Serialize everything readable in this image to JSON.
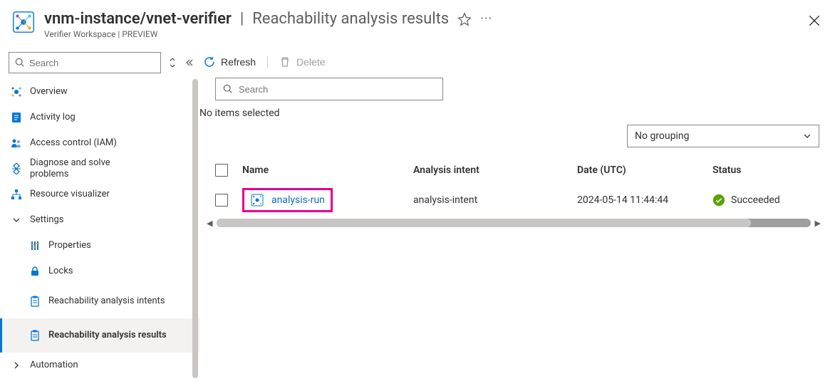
{
  "header": {
    "title_main": "vnm-instance/vnet-verifier",
    "title_section": "Reachability analysis results",
    "subtitle": "Verifier Workspace | PREVIEW"
  },
  "sidebar": {
    "search_placeholder": "Search",
    "items": [
      {
        "label": "Overview",
        "icon": "overview"
      },
      {
        "label": "Activity log",
        "icon": "activity"
      },
      {
        "label": "Access control (IAM)",
        "icon": "access"
      },
      {
        "label": "Diagnose and solve problems",
        "icon": "diagnose"
      },
      {
        "label": "Resource visualizer",
        "icon": "visualizer"
      }
    ],
    "settings_label": "Settings",
    "settings_items": [
      {
        "label": "Properties",
        "icon": "properties"
      },
      {
        "label": "Locks",
        "icon": "locks"
      },
      {
        "label": "Reachability analysis intents",
        "icon": "clipboard"
      },
      {
        "label": "Reachability analysis results",
        "icon": "clipboard",
        "selected": true
      }
    ],
    "automation_label": "Automation"
  },
  "toolbar": {
    "refresh_label": "Refresh",
    "delete_label": "Delete"
  },
  "main": {
    "search_placeholder": "Search",
    "selection_text": "No items selected",
    "grouping_value": "No grouping"
  },
  "table": {
    "headers": {
      "name": "Name",
      "intent": "Analysis intent",
      "date": "Date (UTC)",
      "status": "Status"
    },
    "rows": [
      {
        "name": "analysis-run",
        "intent": "analysis-intent",
        "date": "2024-05-14 11:44:44",
        "status": "Succeeded",
        "status_type": "success",
        "highlighted": true
      }
    ]
  }
}
